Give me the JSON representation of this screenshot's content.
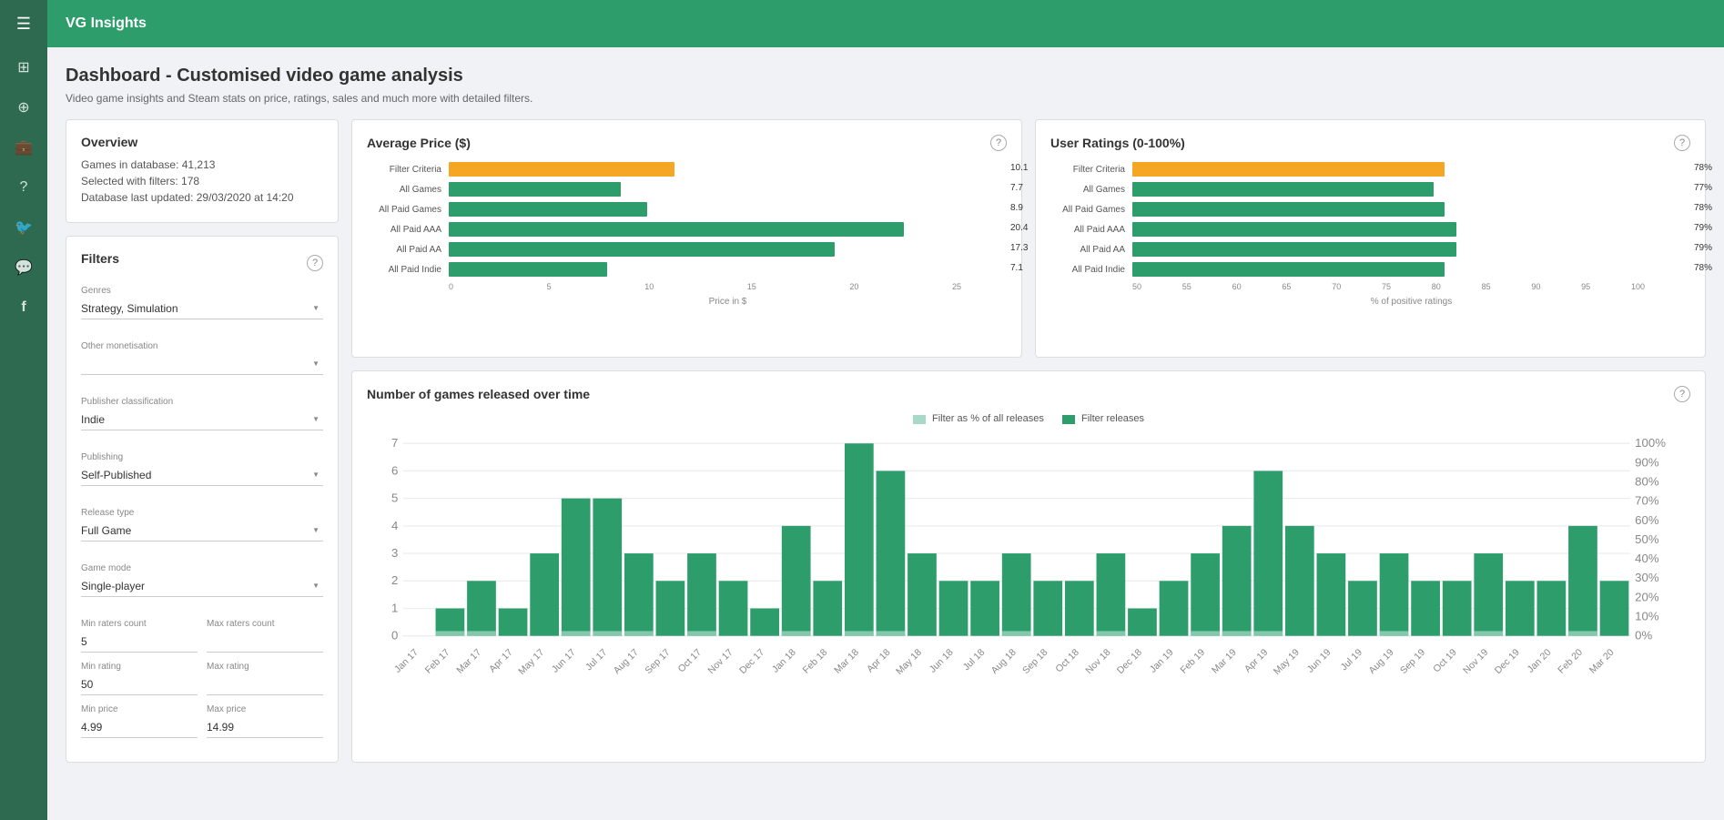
{
  "sidebar": {
    "toggle_icon": "☰",
    "app_title": "VG Insights",
    "icons": [
      "⊞",
      "⊕",
      "💼",
      "?",
      "🐦",
      "💬",
      "f"
    ]
  },
  "page": {
    "title": "Dashboard - Customised video game analysis",
    "subtitle": "Video game insights and Steam stats on price, ratings, sales and much more with detailed filters."
  },
  "overview": {
    "title": "Overview",
    "stats": [
      "Games in database: 41,213",
      "Selected with filters: 178",
      "Database last updated: 29/03/2020 at 14:20"
    ]
  },
  "filters": {
    "title": "Filters",
    "genres_label": "Genres",
    "genres_value": "Strategy, Simulation",
    "monetisation_label": "Other monetisation",
    "monetisation_value": "",
    "publisher_label": "Publisher classification",
    "publisher_value": "Indie",
    "publishing_label": "Publishing",
    "publishing_value": "Self-Published",
    "release_label": "Release type",
    "release_value": "Full Game",
    "game_mode_label": "Game mode",
    "game_mode_value": "Single-player",
    "min_raters_label": "Min raters count",
    "min_raters_value": "5",
    "max_raters_label": "Max raters count",
    "max_raters_value": "",
    "min_rating_label": "Min rating",
    "min_rating_value": "50",
    "max_rating_label": "Max rating",
    "max_rating_value": "",
    "min_price_label": "Min price",
    "min_price_value": "4.99",
    "max_price_label": "Max price",
    "max_price_value": "14.99"
  },
  "avg_price": {
    "title": "Average Price ($)",
    "axis_label": "Price in $",
    "bars": [
      {
        "label": "Filter Criteria",
        "value": 10.1,
        "max": 25,
        "type": "orange"
      },
      {
        "label": "All Games",
        "value": 7.7,
        "max": 25,
        "type": "teal"
      },
      {
        "label": "All Paid Games",
        "value": 8.9,
        "max": 25,
        "type": "teal"
      },
      {
        "label": "All Paid AAA",
        "value": 20.4,
        "max": 25,
        "type": "teal"
      },
      {
        "label": "All Paid AA",
        "value": 17.3,
        "max": 25,
        "type": "teal"
      },
      {
        "label": "All Paid Indie",
        "value": 7.1,
        "max": 25,
        "type": "teal"
      }
    ],
    "axis_ticks": [
      "0",
      "5",
      "10",
      "15",
      "20",
      "25"
    ]
  },
  "user_ratings": {
    "title": "User Ratings (0-100%)",
    "axis_label": "% of positive ratings",
    "bars": [
      {
        "label": "Filter Criteria",
        "value": 78,
        "max": 100,
        "type": "orange",
        "display": "78%"
      },
      {
        "label": "All Games",
        "value": 77,
        "max": 100,
        "type": "teal",
        "display": "77%"
      },
      {
        "label": "All Paid Games",
        "value": 78,
        "max": 100,
        "type": "teal",
        "display": "78%"
      },
      {
        "label": "All Paid AAA",
        "value": 79,
        "max": 100,
        "type": "teal",
        "display": "79%"
      },
      {
        "label": "All Paid AA",
        "value": 79,
        "max": 100,
        "type": "teal",
        "display": "79%"
      },
      {
        "label": "All Paid Indie",
        "value": 78,
        "max": 100,
        "type": "teal",
        "display": "78%"
      }
    ],
    "axis_ticks": [
      "50",
      "55",
      "60",
      "65",
      "70",
      "75",
      "80",
      "85",
      "90",
      "95",
      "100"
    ],
    "axis_min": 50
  },
  "time_chart": {
    "title": "Number of games released over time",
    "legend": [
      {
        "label": "Filter as % of all releases",
        "color": "#a8d8c8"
      },
      {
        "label": "Filter releases",
        "color": "#2d9e6b"
      }
    ],
    "y_left_max": 7,
    "y_right_label": "100%",
    "months": [
      "Jan 17",
      "Feb 17",
      "Mar 17",
      "Apr 17",
      "May 17",
      "Jun 17",
      "Jul 17",
      "Aug 17",
      "Sep 17",
      "Oct 17",
      "Nov 17",
      "Dec 17",
      "Jan 18",
      "Feb 18",
      "Mar 18",
      "Apr 18",
      "May 18",
      "Jun 18",
      "Jul 18",
      "Aug 18",
      "Sep 18",
      "Oct 18",
      "Nov 18",
      "Dec 18",
      "Jan 19",
      "Feb 19",
      "Mar 19",
      "Apr 19",
      "May 19",
      "Jun 19",
      "Jul 19",
      "Aug 19",
      "Sep 19",
      "Oct 19",
      "Nov 19",
      "Dec 19",
      "Jan 20",
      "Feb 20",
      "Mar 20"
    ],
    "filter_bars": [
      0,
      1,
      2,
      1,
      3,
      5,
      5,
      3,
      2,
      3,
      2,
      1,
      4,
      2,
      7,
      6,
      3,
      2,
      2,
      3,
      2,
      2,
      3,
      1,
      2,
      3,
      4,
      6,
      4,
      3,
      2,
      3,
      2,
      2,
      3,
      2,
      2,
      4,
      2
    ],
    "filter_pct": [
      0,
      1,
      1,
      0,
      0,
      1,
      1,
      1,
      0,
      1,
      0,
      0,
      1,
      0,
      1,
      1,
      0,
      0,
      0,
      1,
      0,
      0,
      1,
      0,
      0,
      1,
      1,
      1,
      0,
      0,
      0,
      1,
      0,
      0,
      1,
      0,
      0,
      1,
      0
    ]
  }
}
